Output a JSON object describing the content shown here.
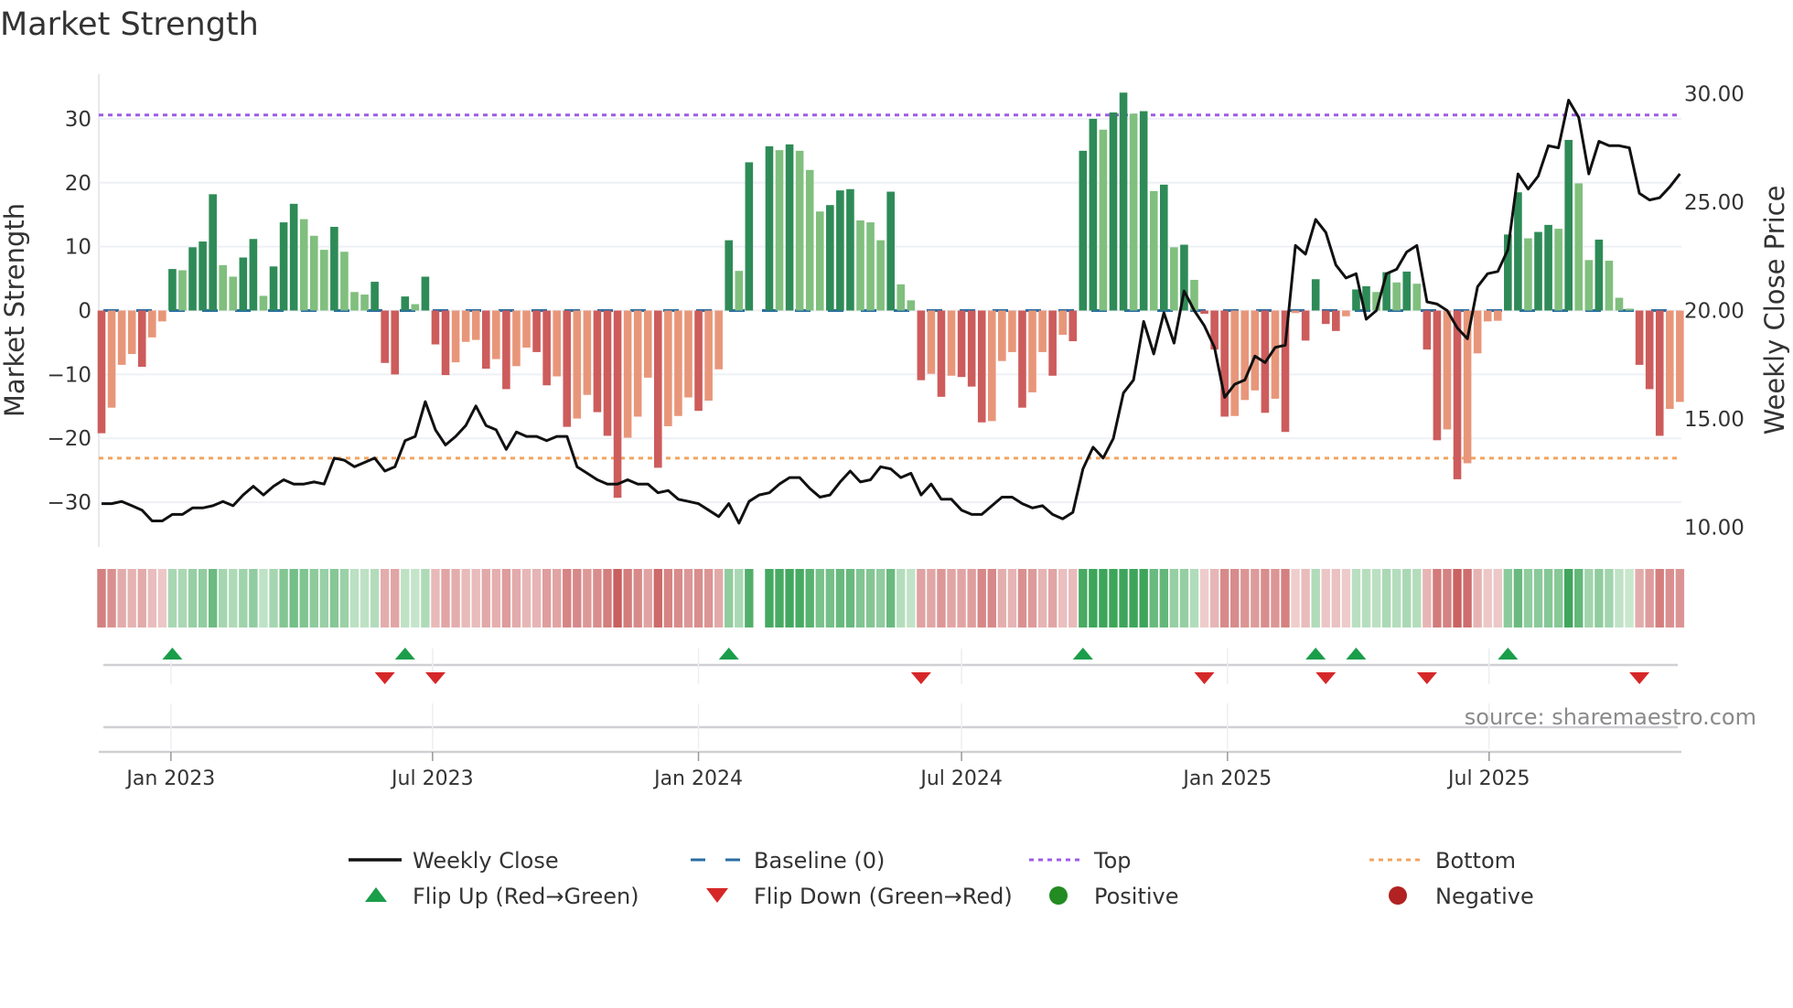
{
  "title": "Market Strength",
  "source_note": "source: sharemaestro.com",
  "colors": {
    "up_strong": "#2e8b57",
    "up_weak": "#80bf7e",
    "down_strong": "#cd5c5c",
    "down_weak": "#e8967a",
    "baseline": "#2b6ea3",
    "top": "#9d5ce6",
    "bottom": "#f2a45f",
    "price": "#111111",
    "flip_up": "#1a9e4a",
    "flip_down": "#d62728",
    "positive": "#228b22",
    "negative": "#b22222"
  },
  "legend": {
    "weekly_close": "Weekly Close",
    "baseline": "Baseline (0)",
    "top": "Top",
    "bottom": "Bottom",
    "flip_up": "Flip Up (Red→Green)",
    "flip_down": "Flip Down (Green→Red)",
    "positive": "Positive",
    "negative": "Negative"
  },
  "chart_data": {
    "type": "bar",
    "title": "Market Strength",
    "ylabel": "Market Strength",
    "y2label": "Weekly Close Price",
    "ylim": [
      -37,
      37
    ],
    "y2lim": [
      9.1,
      30.9
    ],
    "yticks": [
      "30",
      "20",
      "10",
      "0",
      "−10",
      "−20",
      "−30"
    ],
    "ytick_values": [
      30,
      20,
      10,
      0,
      -10,
      -20,
      -30
    ],
    "y2ticks": [
      "30.00",
      "25.00",
      "20.00",
      "15.00",
      "10.00"
    ],
    "y2tick_values": [
      30,
      25,
      20,
      15,
      10
    ],
    "x_start": "2022-11-14",
    "x_step_days": 7,
    "xticks": [
      {
        "label": "Jan 2023",
        "date": "2023-01-01"
      },
      {
        "label": "Jul 2023",
        "date": "2023-07-01"
      },
      {
        "label": "Jan 2024",
        "date": "2024-01-01"
      },
      {
        "label": "Jul 2024",
        "date": "2024-07-01"
      },
      {
        "label": "Jan 2025",
        "date": "2025-01-01"
      },
      {
        "label": "Jul 2025",
        "date": "2025-07-01"
      }
    ],
    "top_level": 30.6,
    "bottom_level": -23.1,
    "baseline": 0,
    "grid": true,
    "legend_placement": "bottom",
    "series": [
      {
        "name": "Market Strength",
        "type": "bar",
        "values": [
          -19.2,
          -15.2,
          -8.5,
          -6.8,
          -8.8,
          -4.2,
          -1.7,
          6.5,
          6.3,
          9.9,
          10.8,
          18.2,
          7.1,
          5.3,
          8.3,
          11.2,
          2.3,
          6.9,
          13.8,
          16.7,
          14.3,
          11.7,
          9.5,
          13.1,
          9.2,
          2.9,
          2.5,
          4.5,
          -8.2,
          -10,
          2.2,
          1.0,
          5.3,
          -5.3,
          -10.1,
          -8.1,
          -4.9,
          -4.6,
          -9.1,
          -7.6,
          -12.3,
          -8.7,
          -5.8,
          -6.5,
          -11.7,
          -10.3,
          -18.2,
          -16.9,
          -13.2,
          -15.9,
          -19.6,
          -29.3,
          -19.9,
          -16.6,
          -10.5,
          -24.6,
          -18.1,
          -16.5,
          -13.6,
          -15.7,
          -14.1,
          -9.2,
          11,
          6.2,
          23.2,
          null,
          25.7,
          25.1,
          26,
          25,
          22,
          15.5,
          16.5,
          18.8,
          19,
          14.1,
          13.8,
          11,
          18.6,
          4.1,
          1.6,
          -10.9,
          -9.9,
          -13.5,
          -10.2,
          -10.4,
          -11.9,
          -17.5,
          -17.3,
          -7.9,
          -6.5,
          -15.2,
          -12.8,
          -6.5,
          -10.2,
          -3.8,
          -4.8,
          25,
          30,
          28.3,
          31,
          34.1,
          30.8,
          31.2,
          18.7,
          19.7,
          9.9,
          10.3,
          4.8,
          -0.5,
          -6.1,
          -16.6,
          -16.5,
          -14,
          -12.5,
          -16,
          -13.8,
          -19,
          -0.4,
          -4.7,
          4.9,
          -2.1,
          -3.2,
          -0.9,
          3.3,
          3.8,
          2.9,
          6,
          4.4,
          6.1,
          4.2,
          -6.1,
          -20.3,
          -18.6,
          -26.4,
          -23.9,
          -6.7,
          -1.7,
          -1.6,
          11.9,
          18.5,
          11.3,
          12.3,
          13.4,
          12.8,
          26.7,
          19.9,
          7.9,
          11.1,
          7.8,
          2,
          0.3,
          -8.5,
          -12.3,
          -19.6,
          -15.4,
          -14.3
        ]
      },
      {
        "name": "Weekly Close",
        "type": "line",
        "axis": "right",
        "values": [
          11.1,
          11.1,
          11.2,
          11.0,
          10.8,
          10.3,
          10.3,
          10.6,
          10.6,
          10.9,
          10.9,
          11.0,
          11.2,
          11.0,
          11.5,
          11.9,
          11.5,
          11.9,
          12.2,
          12.0,
          12.0,
          12.1,
          12.0,
          13.2,
          13.1,
          12.8,
          13.0,
          13.2,
          12.6,
          12.8,
          14.0,
          14.2,
          15.8,
          14.5,
          13.8,
          14.2,
          14.7,
          15.6,
          14.7,
          14.5,
          13.6,
          14.4,
          14.2,
          14.2,
          14.0,
          14.2,
          14.2,
          12.8,
          12.5,
          12.2,
          12.0,
          12.0,
          12.2,
          12.0,
          12.0,
          11.6,
          11.7,
          11.3,
          11.2,
          11.1,
          10.8,
          10.5,
          11.1,
          10.2,
          11.2,
          11.5,
          11.6,
          12.0,
          12.3,
          12.3,
          11.8,
          11.4,
          11.5,
          12.1,
          12.6,
          12.1,
          12.2,
          12.8,
          12.7,
          12.3,
          12.5,
          11.5,
          12.0,
          11.3,
          11.3,
          10.8,
          10.6,
          10.6,
          11.0,
          11.4,
          11.4,
          11.1,
          10.9,
          11.0,
          10.6,
          10.4,
          10.7,
          12.7,
          13.7,
          13.2,
          14.1,
          16.2,
          16.8,
          19.5,
          18.0,
          19.9,
          18.5,
          20.9,
          20.0,
          19.3,
          18.3,
          16.0,
          16.6,
          16.8,
          17.9,
          17.6,
          18.3,
          18.4,
          23.0,
          22.6,
          24.2,
          23.6,
          22.1,
          21.5,
          21.7,
          19.6,
          20.0,
          21.7,
          21.9,
          22.7,
          23.0,
          20.4,
          20.3,
          20.0,
          19.2,
          18.7,
          21.1,
          21.7,
          21.8,
          22.8,
          26.3,
          25.6,
          26.2,
          27.6,
          27.5,
          29.7,
          28.9,
          26.3,
          27.8,
          27.6,
          27.6,
          27.5,
          25.4,
          25.1,
          25.2,
          25.7,
          26.3
        ]
      }
    ],
    "flip_up_weeks": [
      8,
      31,
      63,
      98,
      121,
      125,
      140
    ],
    "flip_down_weeks": [
      29,
      34,
      82,
      110,
      122,
      132,
      153
    ]
  }
}
